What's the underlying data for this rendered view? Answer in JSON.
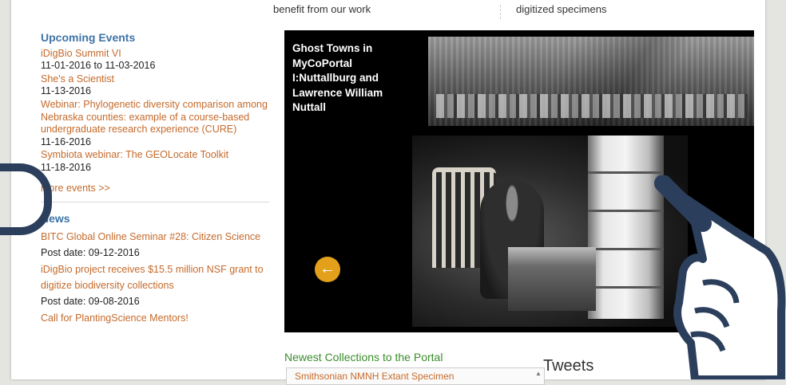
{
  "top": {
    "left_snippet": "benefit from our work",
    "right_snippet": "digitized specimens"
  },
  "events": {
    "title": "Upcoming Events",
    "items": [
      {
        "name": "iDigBio Summit VI",
        "date": "11-01-2016 to 11-03-2016"
      },
      {
        "name": "She's a Scientist",
        "date": "11-13-2016"
      },
      {
        "name": "Webinar: Phylogenetic diversity comparison among Nebraska counties: example of a course-based undergraduate research experience (CURE)",
        "date": "11-16-2016"
      },
      {
        "name": "Symbiota webinar: The GEOLocate Toolkit",
        "date": "11-18-2016"
      }
    ],
    "more_label": "more events >>"
  },
  "news": {
    "title": "News",
    "items": [
      {
        "headline": "BITC Global Online Seminar #28: Citizen Science",
        "date": "Post date: 09-12-2016"
      },
      {
        "headline": "iDigBio project receives $15.5 million NSF grant to digitize biodiversity collections",
        "date": "Post date: 09-08-2016"
      },
      {
        "headline": "Call for PlantingScience Mentors!",
        "date": ""
      }
    ]
  },
  "slideshow": {
    "caption": "Ghost Towns in MyCoPortal I:Nuttallburg and Lawrence William Nuttall",
    "prev_arrow": "←"
  },
  "collections": {
    "title": "Newest Collections to the Portal",
    "first_item": "Smithsonian NMNH Extant Specimen",
    "scroll_arrow": "▲"
  },
  "tweets": {
    "title": "Tweets"
  },
  "colors": {
    "link": "#c56a2b",
    "heading": "#3f74a8",
    "green_heading": "#3a8d2c",
    "accent_button": "#e3a01a"
  }
}
